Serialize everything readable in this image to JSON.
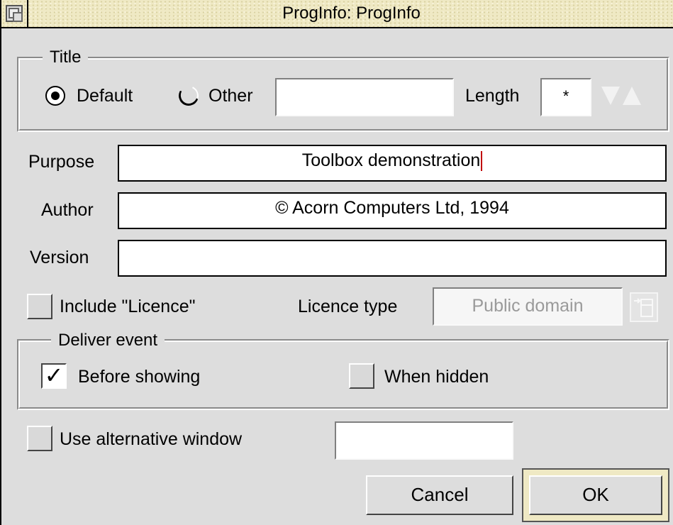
{
  "window": {
    "title": "ProgInfo: ProgInfo"
  },
  "title_group": {
    "label": "Title",
    "default_label": "Default",
    "other_label": "Other",
    "other_value": "",
    "length_label": "Length",
    "length_value": "*",
    "selected": "Default"
  },
  "fields": {
    "purpose_label": "Purpose",
    "purpose_value": "Toolbox demonstration",
    "author_label": "Author",
    "author_value": "© Acorn Computers Ltd, 1994",
    "version_label": "Version",
    "version_value": ""
  },
  "licence": {
    "include_label": "Include \"Licence\"",
    "include_checked": false,
    "type_label": "Licence type",
    "type_value": "Public domain"
  },
  "deliver_event": {
    "label": "Deliver event",
    "before_showing_label": "Before showing",
    "before_showing_checked": true,
    "when_hidden_label": "When hidden",
    "when_hidden_checked": false
  },
  "alt_window": {
    "label": "Use alternative window",
    "checked": false,
    "value": ""
  },
  "buttons": {
    "cancel": "Cancel",
    "ok": "OK"
  },
  "icons": {
    "back": "window-back-icon",
    "adjust_down": "arrow-down-icon",
    "adjust_up": "arrow-up-icon",
    "menu": "popup-menu-icon"
  },
  "colors": {
    "window_bg": "#dddddd",
    "title_bg": "#efe9c4",
    "caret": "#c00000"
  }
}
